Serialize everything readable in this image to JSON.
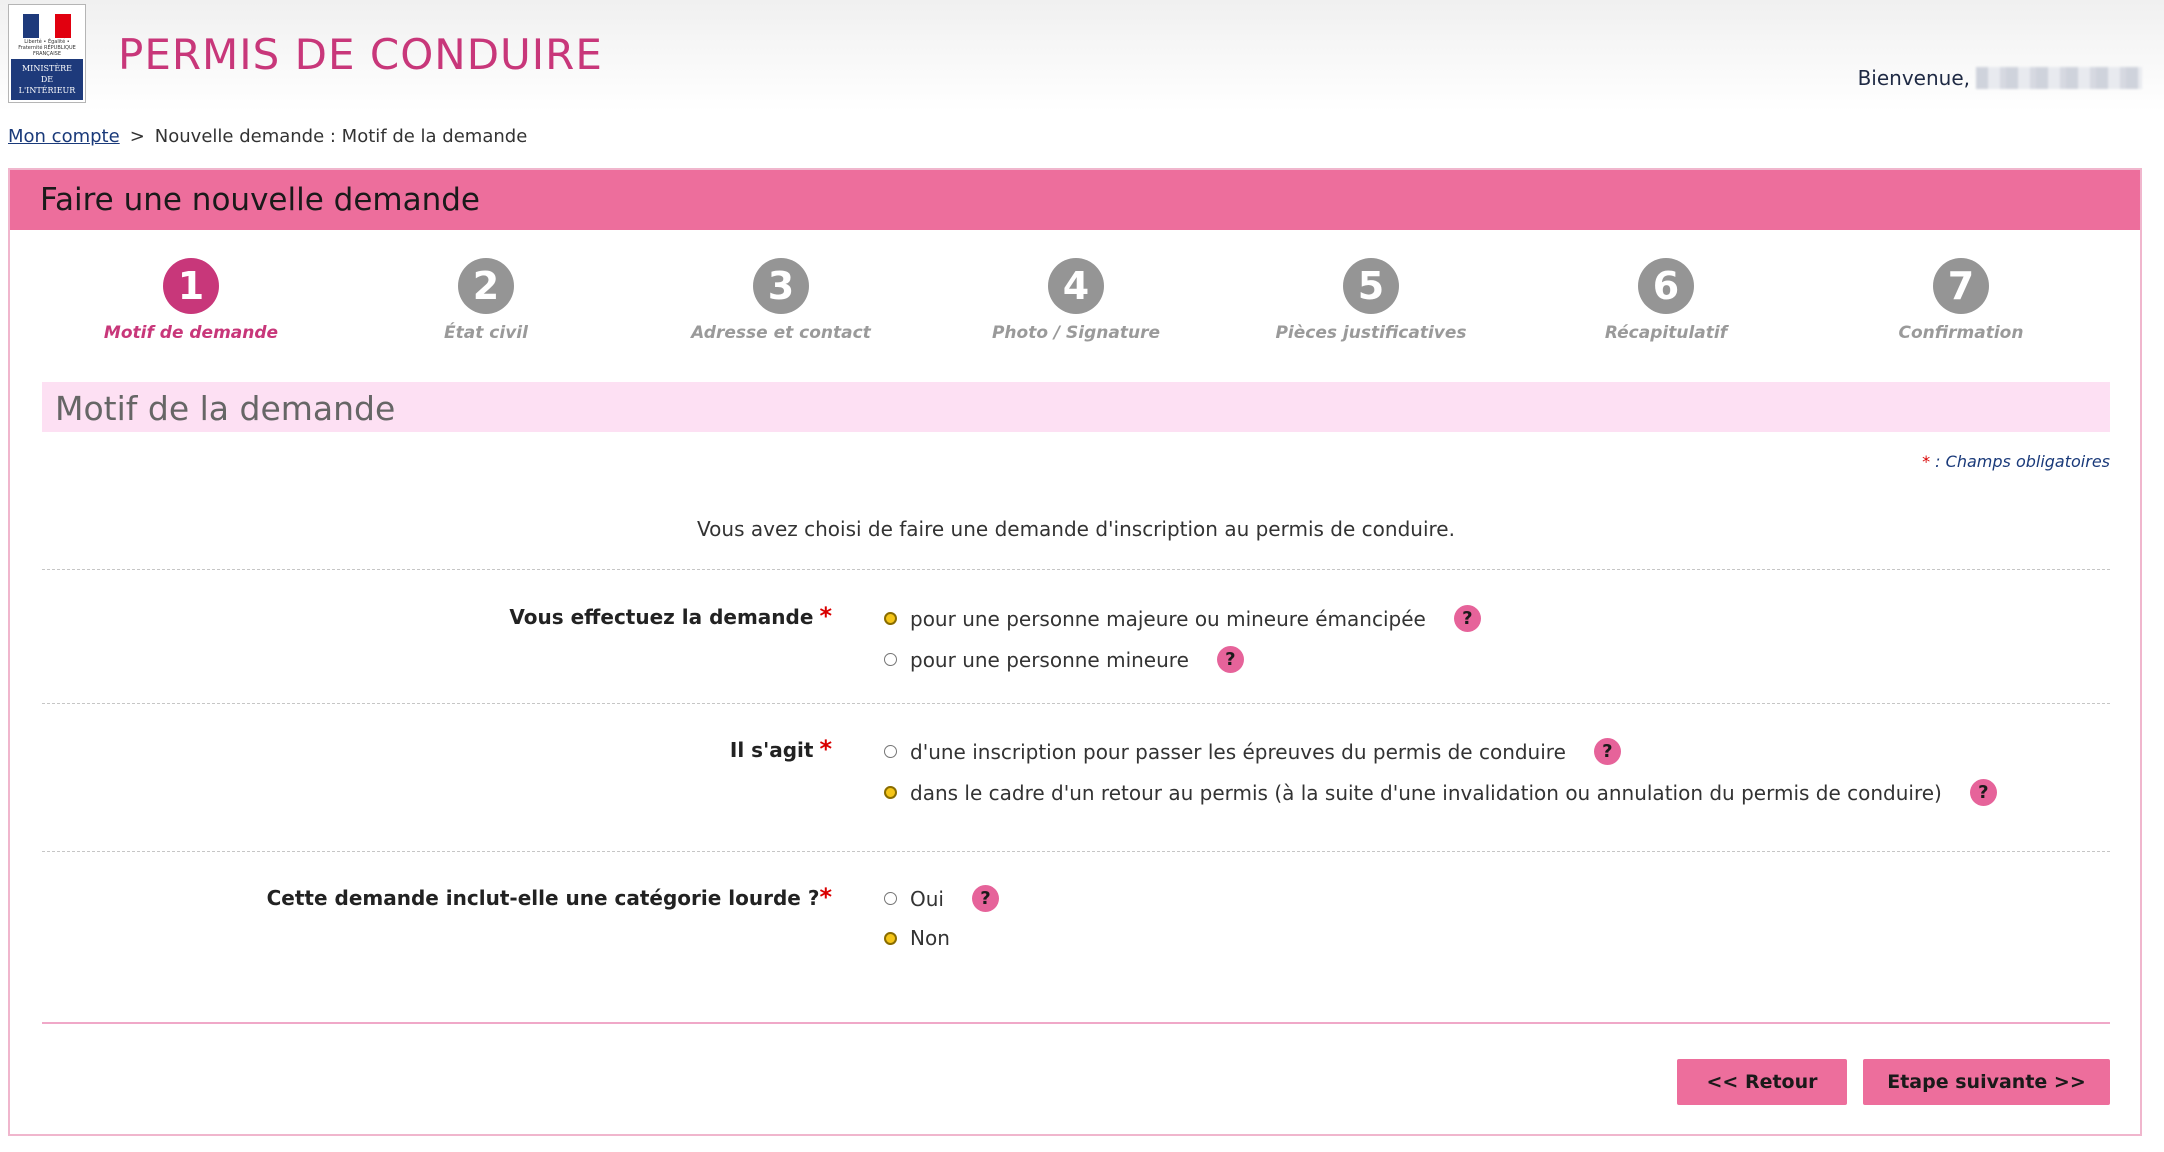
{
  "header": {
    "app_title": "PERMIS DE CONDUIRE",
    "welcome_label": "Bienvenue,",
    "logo": {
      "republic_text": "Liberté • Égalité • Fraternité\nRÉPUBLIQUE FRANÇAISE",
      "ministry_line1": "MINISTÈRE",
      "ministry_line2": "DE",
      "ministry_line3": "L'INTÉRIEUR"
    }
  },
  "breadcrumb": {
    "home_link": "Mon compte",
    "separator": ">",
    "current": "Nouvelle demande : Motif de la demande"
  },
  "panel": {
    "title": "Faire une nouvelle demande"
  },
  "steps": [
    {
      "number": "1",
      "label": "Motif de demande",
      "active": true
    },
    {
      "number": "2",
      "label": "État civil",
      "active": false
    },
    {
      "number": "3",
      "label": "Adresse et contact",
      "active": false
    },
    {
      "number": "4",
      "label": "Photo / Signature",
      "active": false
    },
    {
      "number": "5",
      "label": "Pièces justificatives",
      "active": false
    },
    {
      "number": "6",
      "label": "Récapitulatif",
      "active": false
    },
    {
      "number": "7",
      "label": "Confirmation",
      "active": false
    }
  ],
  "section": {
    "title": "Motif de la demande",
    "required_star": "*",
    "required_note": " : Champs obligatoires",
    "intro": "Vous avez choisi de faire une demande d'inscription au permis de conduire."
  },
  "fields": {
    "demande": {
      "label": "Vous effectuez la demande",
      "star": "*",
      "options": [
        {
          "label": "pour une personne majeure ou mineure émancipée",
          "selected": true
        },
        {
          "label": "pour une personne mineure",
          "selected": false
        }
      ]
    },
    "type": {
      "label": "Il s'agit",
      "star": "*",
      "options": [
        {
          "label": "d'une inscription pour passer les épreuves du permis de conduire",
          "selected": false
        },
        {
          "label": "dans le cadre d'un retour au permis (à la suite d'une invalidation ou annulation du permis de conduire)",
          "selected": true
        }
      ]
    },
    "lourde": {
      "label": "Cette demande inclut-elle une catégorie lourde ?",
      "star": "*",
      "options": [
        {
          "label": "Oui",
          "selected": false
        },
        {
          "label": "Non",
          "selected": true
        }
      ]
    }
  },
  "help_symbol": "?",
  "buttons": {
    "back": "<<  Retour",
    "next": "Etape suivante  >>"
  },
  "colors": {
    "brand_pink": "#c8377a",
    "panel_header": "#ed6e9c",
    "section_bg": "#fde0f3",
    "help_pink": "#e6639a",
    "radio_selected": "#f5c518",
    "required_red": "#d90000",
    "inactive_step": "#959595",
    "ministry_blue": "#1e3a7b"
  }
}
